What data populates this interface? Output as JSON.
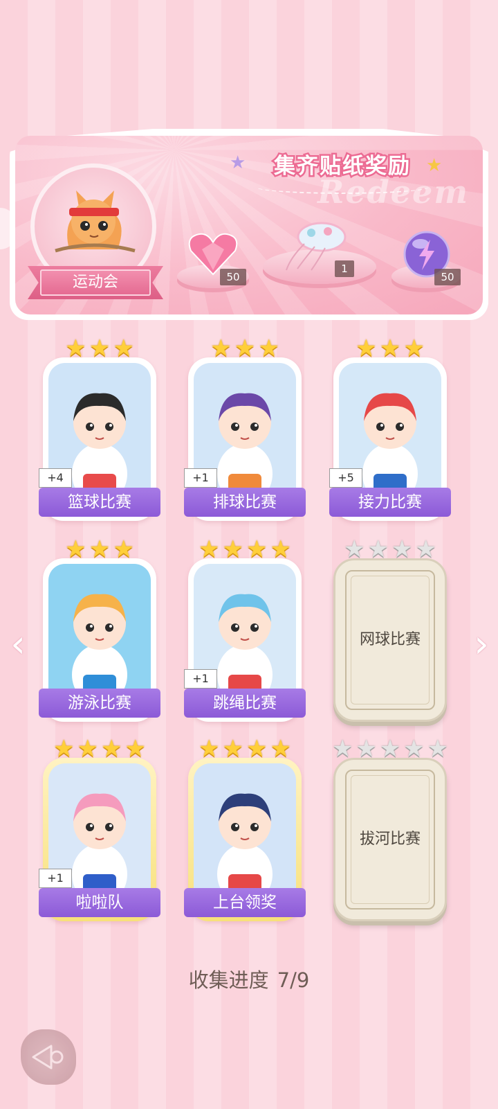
{
  "banner": {
    "title": "集齐贴纸奖励",
    "watermark": "Redeem",
    "event_name": "运动会",
    "rewards": [
      {
        "icon": "heart-gem-icon",
        "count": "50"
      },
      {
        "icon": "jellyfish-ribbon-icon",
        "count": "1"
      },
      {
        "icon": "lightning-orb-icon",
        "count": "50"
      }
    ]
  },
  "cards": [
    {
      "name": "篮球比赛",
      "stars": 3,
      "plus": "+4",
      "locked": false
    },
    {
      "name": "排球比赛",
      "stars": 3,
      "plus": "+1",
      "locked": false
    },
    {
      "name": "接力比赛",
      "stars": 3,
      "plus": "+5",
      "locked": false
    },
    {
      "name": "游泳比赛",
      "stars": 3,
      "plus": "",
      "locked": false
    },
    {
      "name": "跳绳比赛",
      "stars": 4,
      "plus": "+1",
      "locked": false
    },
    {
      "name": "网球比赛",
      "stars": 4,
      "plus": "",
      "locked": true
    },
    {
      "name": "啦啦队",
      "stars": 4,
      "plus": "+1",
      "locked": false
    },
    {
      "name": "上台领奖",
      "stars": 4,
      "plus": "",
      "locked": false
    },
    {
      "name": "拔河比赛",
      "stars": 5,
      "plus": "",
      "locked": true
    }
  ],
  "progress": {
    "label": "收集进度",
    "value": "7/9"
  },
  "colors": {
    "accent": "#ec6b93",
    "label_purple": "#9666dd",
    "star_gold": "#ffcf3a"
  }
}
